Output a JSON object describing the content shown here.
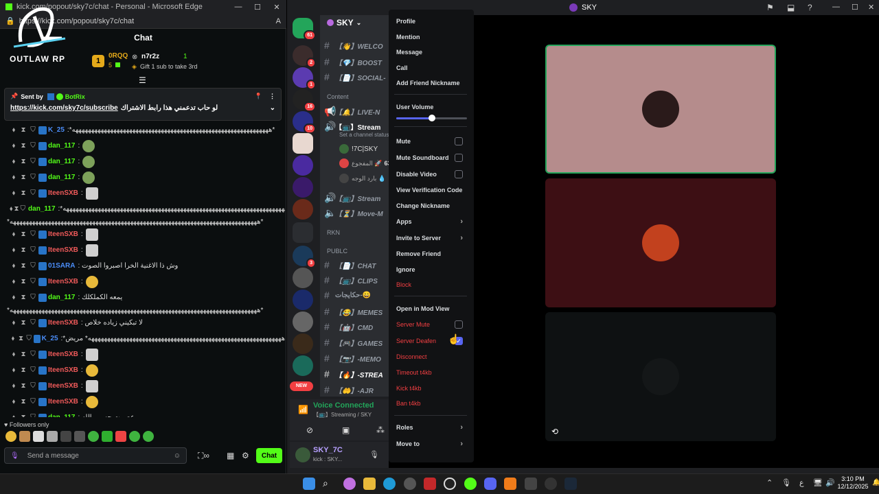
{
  "edge": {
    "title": "kick.com/popout/sky7c/chat - Personal - Microsoft Edge",
    "url": "https://kick.com/popout/sky7c/chat",
    "chat_title": "Chat",
    "logo_text": "OUTLAW RP",
    "leaderboard": {
      "rank1": "1",
      "user1": "0RQQ",
      "count1": "5",
      "user2": "n7r2z",
      "count2": "1",
      "gift_text": "Gift 1 sub to take 3rd"
    },
    "pinned": {
      "sent_by": "Sent by",
      "sender": "BotRix",
      "link": "https://kick.com/sky7c/subscribe",
      "message": "لو حاب تدعمني هذا رابط الاشتراك"
    },
    "messages": [
      {
        "user": "K_25",
        "color": "#4b8df8",
        "text": ":*ههههههههههههههههههههههههههههههههههههههههههههههههههههههههههههههه*",
        "emote": ""
      },
      {
        "user": "dan_117",
        "color": "#53fc18",
        "text": ":",
        "emote": "green"
      },
      {
        "user": "dan_117",
        "color": "#53fc18",
        "text": ":",
        "emote": "green"
      },
      {
        "user": "dan_117",
        "color": "#53fc18",
        "text": ":",
        "emote": "green"
      },
      {
        "user": "IteenSXB",
        "color": "#f05a5a",
        "text": ":",
        "emote": "cat"
      },
      {
        "user": "dan_117",
        "color": "#53fc18",
        "text": ":*هههههههههههههههههههههههههههههههههههههههههههههههههههههههههههههههههههههههه*",
        "emote": ""
      },
      {
        "wrap": "*ههههههههههههههههههههههههههههههههههههههههههههههههههههههههههههههههههههههههههههههه*"
      },
      {
        "user": "IteenSXB",
        "color": "#f05a5a",
        "text": ":",
        "emote": "cat"
      },
      {
        "user": "IteenSXB",
        "color": "#f05a5a",
        "text": ":",
        "emote": "cat"
      },
      {
        "user": "01SARA",
        "color": "#4b8df8",
        "text": ": وش ذا الاغنية الخرا اصبروا الصوت",
        "emote": ""
      },
      {
        "user": "IteenSXB",
        "color": "#f05a5a",
        "text": ":",
        "emote": "yel"
      },
      {
        "user": "dan_117",
        "color": "#53fc18",
        "text": ": يمعه الكملكلك",
        "emote": ""
      },
      {
        "wrap": "*ههههههههههههههههههههههههههههههههههههههههههههههههههههههههههههههههههههههههههههههه*"
      },
      {
        "user": "IteenSXB",
        "color": "#f05a5a",
        "text": ": لا تبكيني زياده خلاص",
        "emote": ""
      },
      {
        "user": "K_25",
        "color": "#4b8df8",
        "text": ":*هههههههههههههههههههههههههههههههههههههههههههههههههههههههههههههه* مريض",
        "emote": ""
      },
      {
        "user": "IteenSXB",
        "color": "#f05a5a",
        "text": ":",
        "emote": "cat"
      },
      {
        "user": "IteenSXB",
        "color": "#f05a5a",
        "text": ":",
        "emote": "yel"
      },
      {
        "user": "IteenSXB",
        "color": "#f05a5a",
        "text": ":",
        "emote": "cat"
      },
      {
        "user": "IteenSXB",
        "color": "#f05a5a",
        "text": ":",
        "emote": "yel"
      },
      {
        "user": "dan_117",
        "color": "#53fc18",
        "text": ": عصبيت حسبي الله",
        "emote": ""
      }
    ],
    "followers_only": "Followers only",
    "input_placeholder": "Send a message",
    "chat_button": "Chat"
  },
  "discord": {
    "title": "SKY",
    "server_name": "SKY",
    "guild_badges": [
      "61",
      "2",
      "1",
      "16",
      "10",
      "3"
    ],
    "new_label": "NEW",
    "categories": {
      "content": "Content",
      "rkn": "RKN",
      "public": "PUBLC"
    },
    "channels": {
      "welcome": "【👋】WELCO",
      "boost": "【💎】BOOST",
      "social": "【📄】SOCIAL-",
      "live": "【🔔】LIVE-N",
      "stream": "【📺】Stream",
      "stream_status": "Set a channel status",
      "stream2": "【📺】Stream",
      "move": "【⏳】Move-M",
      "chat": "【📄】CHAT",
      "clips": "【📺】CLIPS",
      "clips_ar": "حكايجات-😄",
      "memes": "【😂】MEMES",
      "cmd": "【🤖】CMD",
      "games": "【🎮】GAMES",
      "memo": "【📷】-MEMO",
      "stream3": "【🔥】-STREA",
      "ajr": "【🤲】-AJR"
    },
    "voice_users": [
      {
        "name": "!7C|SKY",
        "extra": ""
      },
      {
        "name": "المفجوع 🚀",
        "extra": "636"
      },
      {
        "name": "بارد الوجه 💧",
        "extra": ""
      }
    ],
    "voice_connected": "Voice Connected",
    "voice_channel": "【📺】Streaming / SKY",
    "username": "SKY_7C",
    "user_status": "kick : SKY...",
    "menu": {
      "profile": "Profile",
      "mention": "Mention",
      "message": "Message",
      "call": "Call",
      "add_nick": "Add Friend Nickname",
      "user_volume": "User Volume",
      "volume_level": 0.5,
      "mute": "Mute",
      "mute_soundboard": "Mute Soundboard",
      "disable_video": "Disable Video",
      "verification": "View Verification Code",
      "change_nick": "Change Nickname",
      "apps": "Apps",
      "invite": "Invite to Server",
      "remove_friend": "Remove Friend",
      "ignore": "Ignore",
      "block": "Block",
      "mod_view": "Open in Mod View",
      "server_mute": "Server Mute",
      "server_deafen": "Server Deafen",
      "disconnect": "Disconnect",
      "timeout": "Timeout t4kb",
      "kick": "Kick t4kb",
      "ban": "Ban t4kb",
      "roles": "Roles",
      "move_to": "Move to"
    }
  },
  "taskbar": {
    "time": "3:10 PM",
    "date": "12/12/2025",
    "lang": "ع"
  },
  "colors": {
    "kick_green": "#53fc18",
    "discord_blurple": "#5865f2",
    "danger": "#f23f42"
  }
}
